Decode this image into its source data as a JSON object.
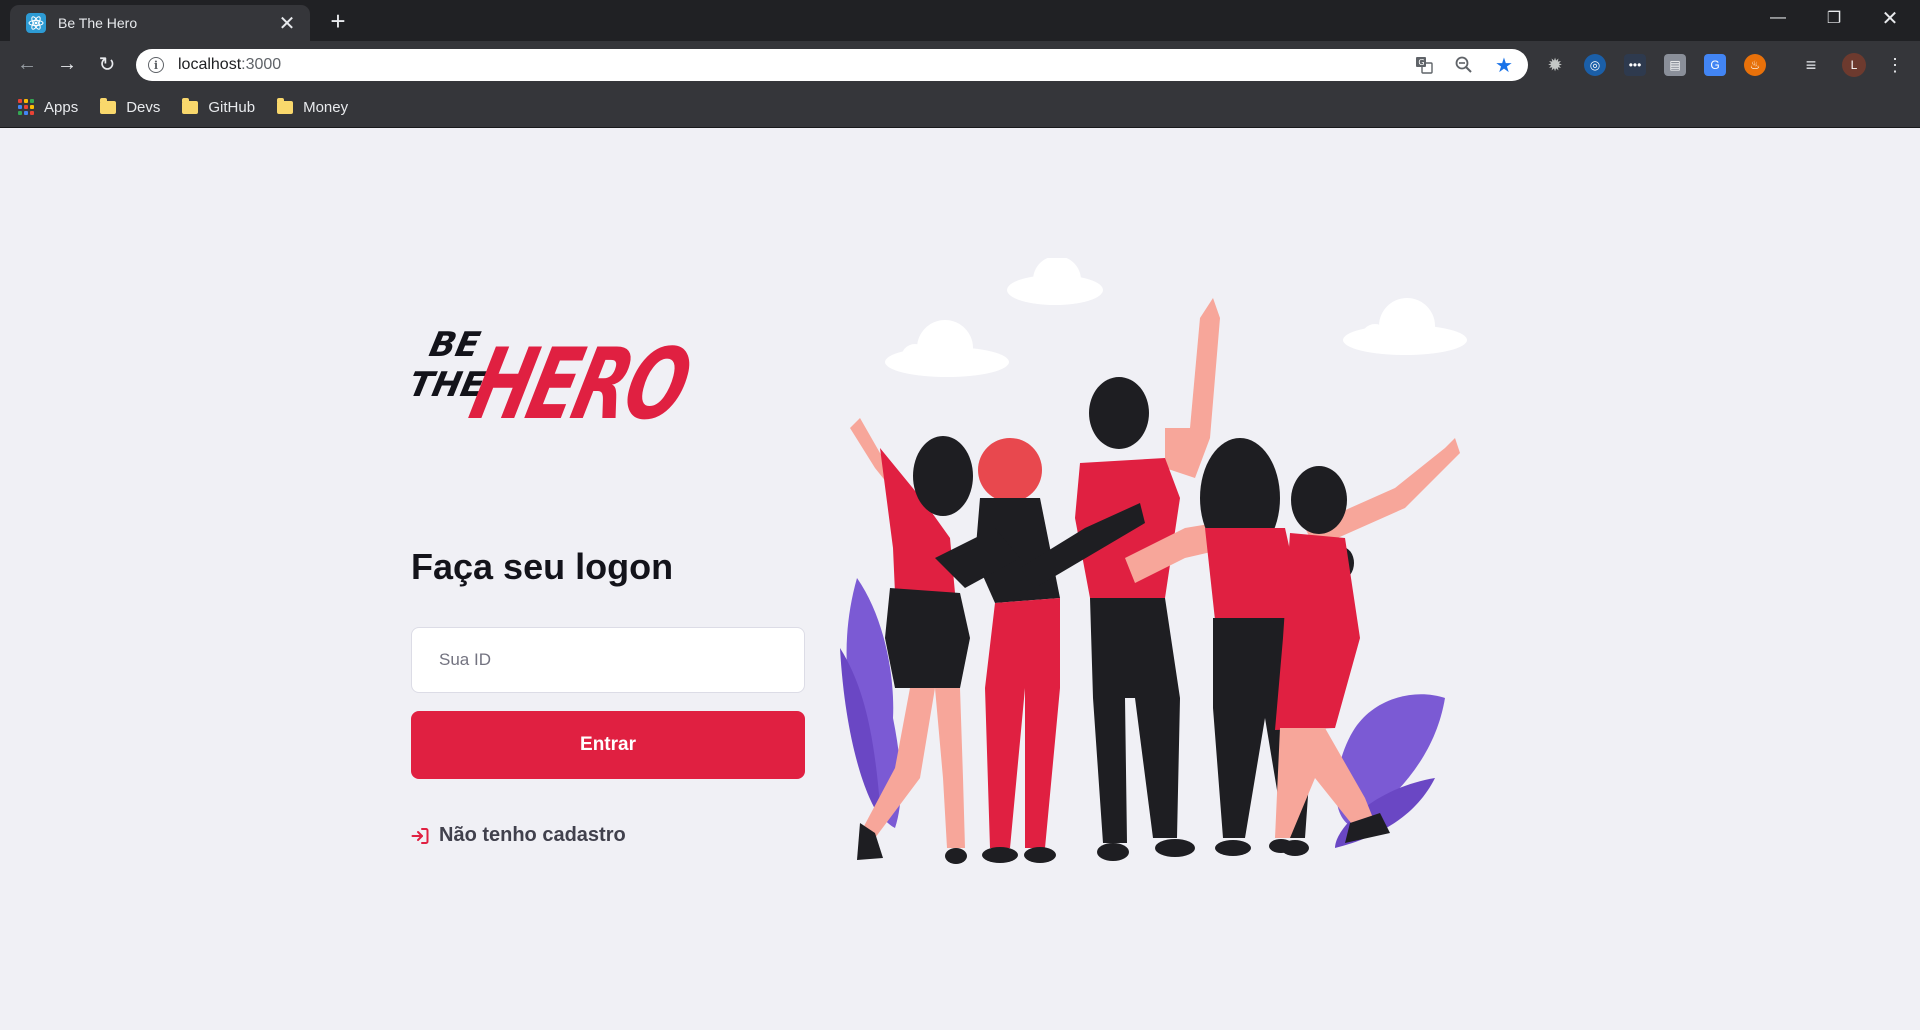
{
  "browser": {
    "tab_title": "Be The Hero",
    "url_host": "localhost",
    "url_port": ":3000",
    "profile_initial": "L",
    "bookmarks": [
      {
        "label": "Apps",
        "icon": "apps-grid-icon"
      },
      {
        "label": "Devs",
        "icon": "folder-icon"
      },
      {
        "label": "GitHub",
        "icon": "folder-icon"
      },
      {
        "label": "Money",
        "icon": "folder-icon"
      }
    ]
  },
  "page": {
    "logo": {
      "line1": "BE",
      "line2": "THE",
      "word": "HERO"
    },
    "title": "Faça seu logon",
    "id_input": {
      "placeholder": "Sua ID",
      "value": ""
    },
    "submit_label": "Entrar",
    "register_link": "Não tenho cadastro",
    "illustration": "group-of-friends-hugging-illustration"
  },
  "colors": {
    "brand_red": "#e02041",
    "background": "#f0f0f5",
    "text_dark": "#13131a",
    "link_text": "#41414d"
  }
}
